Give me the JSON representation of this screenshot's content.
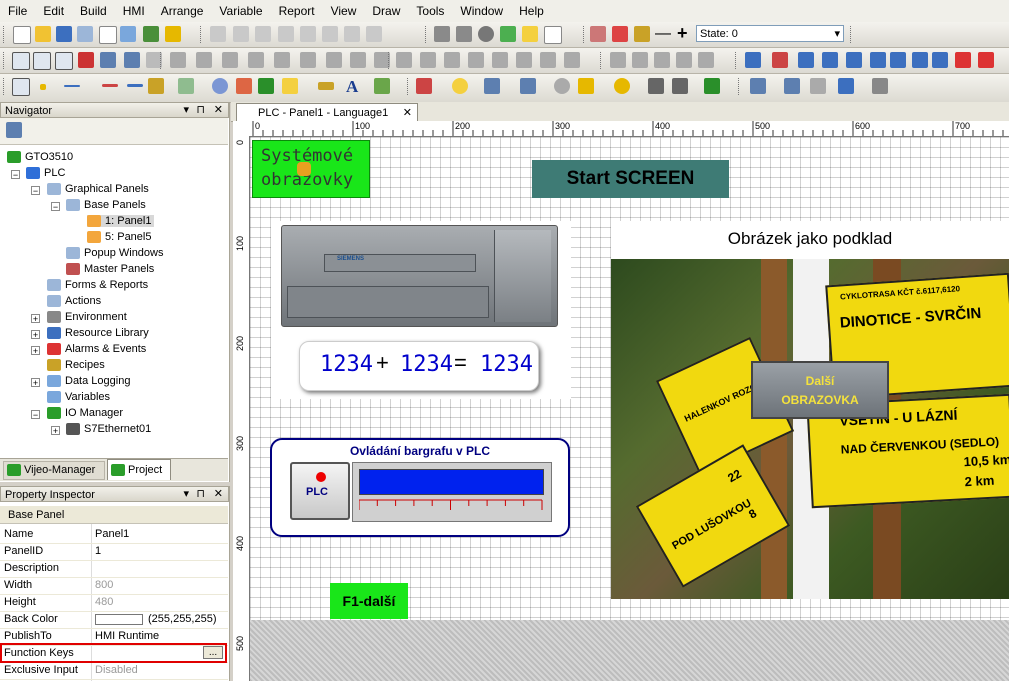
{
  "menu": [
    "File",
    "Edit",
    "Build",
    "HMI",
    "Arrange",
    "Variable",
    "Report",
    "View",
    "Draw",
    "Tools",
    "Window",
    "Help"
  ],
  "toolbar": {
    "state_label": "State: 0"
  },
  "navigator": {
    "title": "Navigator",
    "tree": [
      {
        "label": "GTO3510"
      },
      {
        "label": "PLC"
      },
      {
        "label": "Graphical Panels"
      },
      {
        "label": "Base Panels"
      },
      {
        "label": "1: Panel1"
      },
      {
        "label": "5: Panel5"
      },
      {
        "label": "Popup Windows"
      },
      {
        "label": "Master Panels"
      },
      {
        "label": "Forms & Reports"
      },
      {
        "label": "Actions"
      },
      {
        "label": "Environment"
      },
      {
        "label": "Resource Library"
      },
      {
        "label": "Alarms & Events"
      },
      {
        "label": "Recipes"
      },
      {
        "label": "Data Logging"
      },
      {
        "label": "Variables"
      },
      {
        "label": "IO Manager"
      },
      {
        "label": "S7Ethernet01"
      }
    ],
    "tabs": [
      "Vijeo-Manager",
      "Project"
    ]
  },
  "property_inspector": {
    "title": "Property Inspector",
    "section": "Base Panel",
    "rows": [
      {
        "name": "Name",
        "value": "Panel1"
      },
      {
        "name": "PanelID",
        "value": "1"
      },
      {
        "name": "Description",
        "value": ""
      },
      {
        "name": "Width",
        "value": "800"
      },
      {
        "name": "Height",
        "value": "480"
      },
      {
        "name": "Back Color",
        "value": "(255,255,255)"
      },
      {
        "name": "PublishTo",
        "value": "HMI Runtime"
      },
      {
        "name": "Function Keys",
        "value": ""
      },
      {
        "name": "Exclusive Input",
        "value": "Disabled"
      }
    ],
    "ellipsis": "..."
  },
  "document": {
    "tab_title": "PLC - Panel1 - Language1",
    "ruler_h": [
      "0",
      "100",
      "200",
      "300",
      "400",
      "500",
      "600",
      "700"
    ],
    "ruler_v": [
      "0",
      "100",
      "200",
      "300",
      "400",
      "500"
    ],
    "sys_button": "Systémové obrazovky",
    "start_screen": "Start SCREEN",
    "image_caption": "Obrázek jako podklad",
    "display_a": "1234",
    "display_b": "1234",
    "display_c": "1234",
    "plus": "+",
    "equals": "=",
    "bargraph_title": "Ovládání bargrafu v PLC",
    "plc_button": "PLC",
    "bargraph_level": 1.0,
    "next_button": "Další OBRAZOVKA",
    "f1_button": "F1-další",
    "plc_brand": "SIEMENS",
    "sign_texts": [
      "CYKLOTRASA KČT č.6117,6120",
      "DINOTICE - SVRČIN",
      "VSETÍN - U LÁZNÍ",
      "NAD ČERVENKOU (SEDLO)",
      "10,5 km",
      "2 km",
      "HALENKOV ROZC",
      "POD LUŠOVKOU",
      "22",
      "8"
    ]
  },
  "colors": {
    "accent_green": "#19e619",
    "teal": "#3e7b75",
    "bar_blue": "#0022ee",
    "nav_border": "#000080",
    "highlight_red": "#e00000"
  }
}
